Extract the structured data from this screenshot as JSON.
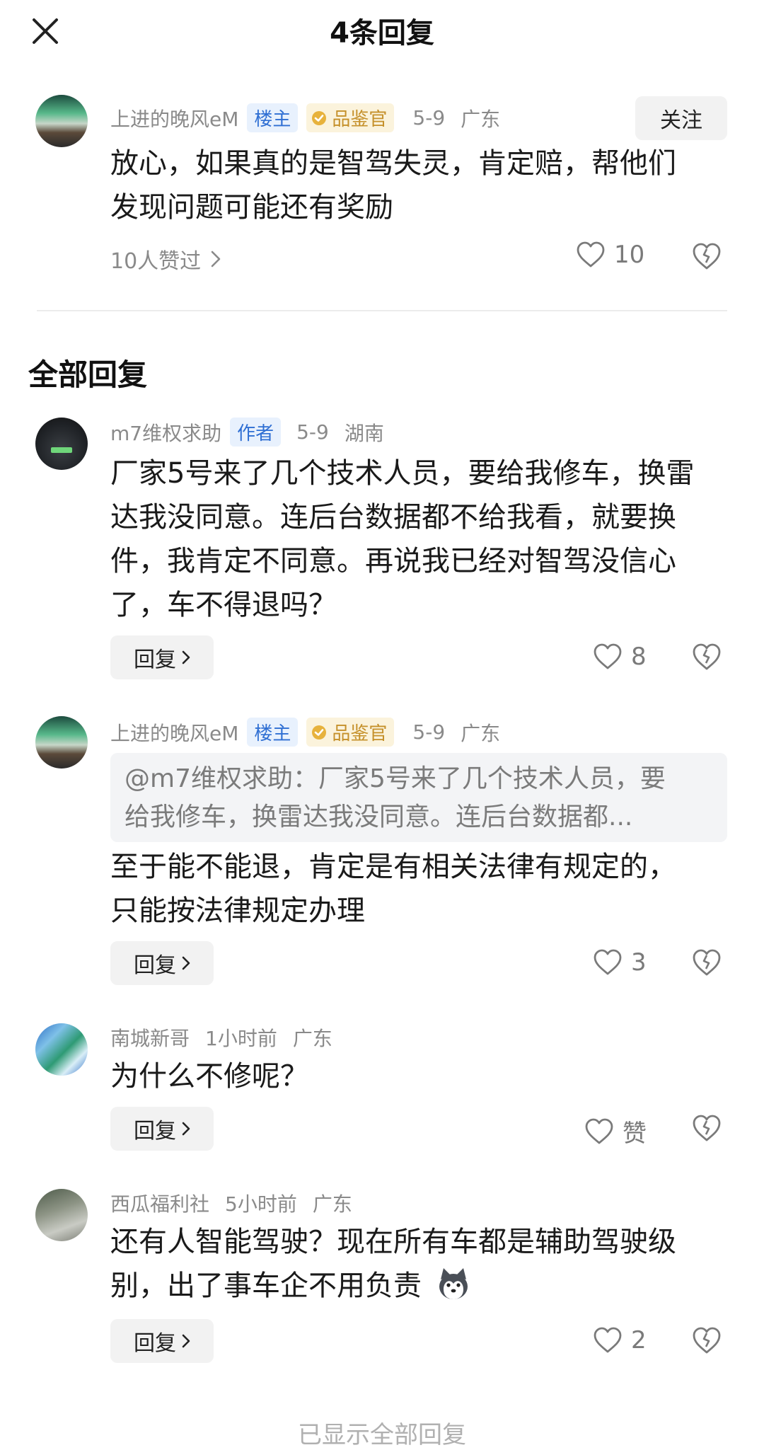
{
  "header": {
    "title": "4条回复"
  },
  "top_comment": {
    "username": "上进的晚风eM",
    "badges": [
      "楼主",
      "品鉴官"
    ],
    "date": "5-9",
    "location": "广东",
    "follow_label": "关注",
    "text_lines": [
      "放心，如果真的是智驾失灵，肯定赔，帮他们",
      "发现问题可能还有奖励"
    ],
    "liked_by": "10人赞过",
    "likes": "10"
  },
  "section_title": "全部回复",
  "replies": [
    {
      "username": "m7维权求助",
      "badge": "作者",
      "date": "5-9",
      "location": "湖南",
      "text_lines": [
        "厂家5号来了几个技术人员，要给我修车，换雷",
        "达我没同意。连后台数据都不给我看，就要换",
        "件，我肯定不同意。再说我已经对智驾没信心",
        "了，车不得退吗？"
      ],
      "reply_label": "回复",
      "likes": "8"
    },
    {
      "username": "上进的晚风eM",
      "badges": [
        "楼主",
        "品鉴官"
      ],
      "date": "5-9",
      "location": "广东",
      "quote_lines": [
        "@m7维权求助：厂家5号来了几个技术人员，要",
        "给我修车，换雷达我没同意。连后台数据都..."
      ],
      "text_lines": [
        "至于能不能退，肯定是有相关法律有规定的，",
        "只能按法律规定办理"
      ],
      "reply_label": "回复",
      "likes": "3"
    },
    {
      "username": "南城新哥",
      "time": "1小时前",
      "location": "广东",
      "text_lines": [
        "为什么不修呢？"
      ],
      "reply_label": "回复",
      "likes": "赞"
    },
    {
      "username": "西瓜福利社",
      "time": "5小时前",
      "location": "广东",
      "text_lines": [
        "还有人智能驾驶？现在所有车都是辅助驾驶级",
        "别，出了事车企不用负责"
      ],
      "reply_label": "回复",
      "likes": "2"
    }
  ],
  "footer": {
    "end_text": "已显示全部回复"
  },
  "icons": {
    "close": "close-icon",
    "heart": "heart-icon",
    "broken_heart": "dislike-icon",
    "chevron": "chevron-right-icon",
    "emoji": "husky-emoji"
  }
}
